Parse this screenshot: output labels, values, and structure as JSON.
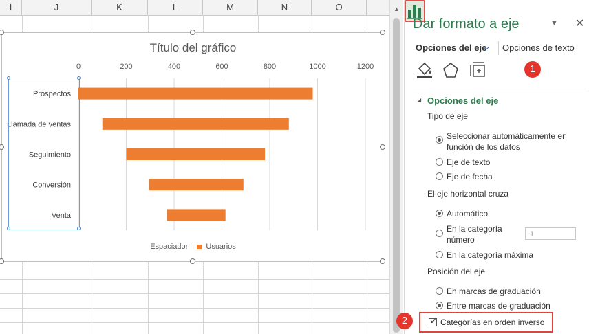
{
  "columns": [
    "I",
    "J",
    "K",
    "L",
    "M",
    "N",
    "O"
  ],
  "chart": {
    "title": "Título del gráfico",
    "legend": {
      "spacer": "Espaciador",
      "users": "Usuarios"
    }
  },
  "chart_data": {
    "type": "bar",
    "orientation": "horizontal",
    "stacked": true,
    "categories": [
      "Prospectos",
      "Llamada de ventas",
      "Seguimiento",
      "Conversión",
      "Venta"
    ],
    "series": [
      {
        "name": "Espaciador",
        "values": [
          0,
          100,
          200,
          295,
          370
        ],
        "color": "none"
      },
      {
        "name": "Usuarios",
        "values": [
          980,
          780,
          580,
          395,
          245
        ],
        "color": "#ed7d31"
      }
    ],
    "x_ticks": [
      0,
      200,
      400,
      600,
      800,
      1000,
      1200
    ],
    "xlim": [
      0,
      1200
    ],
    "grid": true,
    "legend_position": "bottom"
  },
  "pane": {
    "title": "Dar formato a eje",
    "tab_axis": "Opciones del eje",
    "tab_text": "Opciones de texto",
    "icons": [
      "fill-line-icon",
      "effects-icon",
      "size-properties-icon",
      "axis-options-icon"
    ],
    "badge1": "1",
    "badge2": "2",
    "section_title": "Opciones del eje",
    "axis_type_label": "Tipo de eje",
    "axis_type_options": {
      "auto": "Seleccionar automáticamente en función de los datos",
      "auto_line1": "Seleccionar automáticamente en",
      "auto_line2": "función de los datos",
      "text": "Eje de texto",
      "date": "Eje de fecha"
    },
    "cross_label": "El eje horizontal cruza",
    "cross_options": {
      "auto": "Automático",
      "at_category_line1": "En la categoría",
      "at_category_line2": "número",
      "max_category": "En la categoría máxima"
    },
    "category_number": "1",
    "position_label": "Posición del eje",
    "position_options": {
      "on_ticks": "En marcas de graduación",
      "between_ticks": "Entre marcas de graduación"
    },
    "reverse_label": "Categorías en orden inverso",
    "reverse_checked": true,
    "selected": {
      "axis_type": "auto",
      "cross": "auto",
      "position": "between_ticks"
    }
  },
  "colors": {
    "accent_green": "#2d7d4f",
    "bar": "#ed7d31",
    "highlight_red": "#e0443b"
  }
}
